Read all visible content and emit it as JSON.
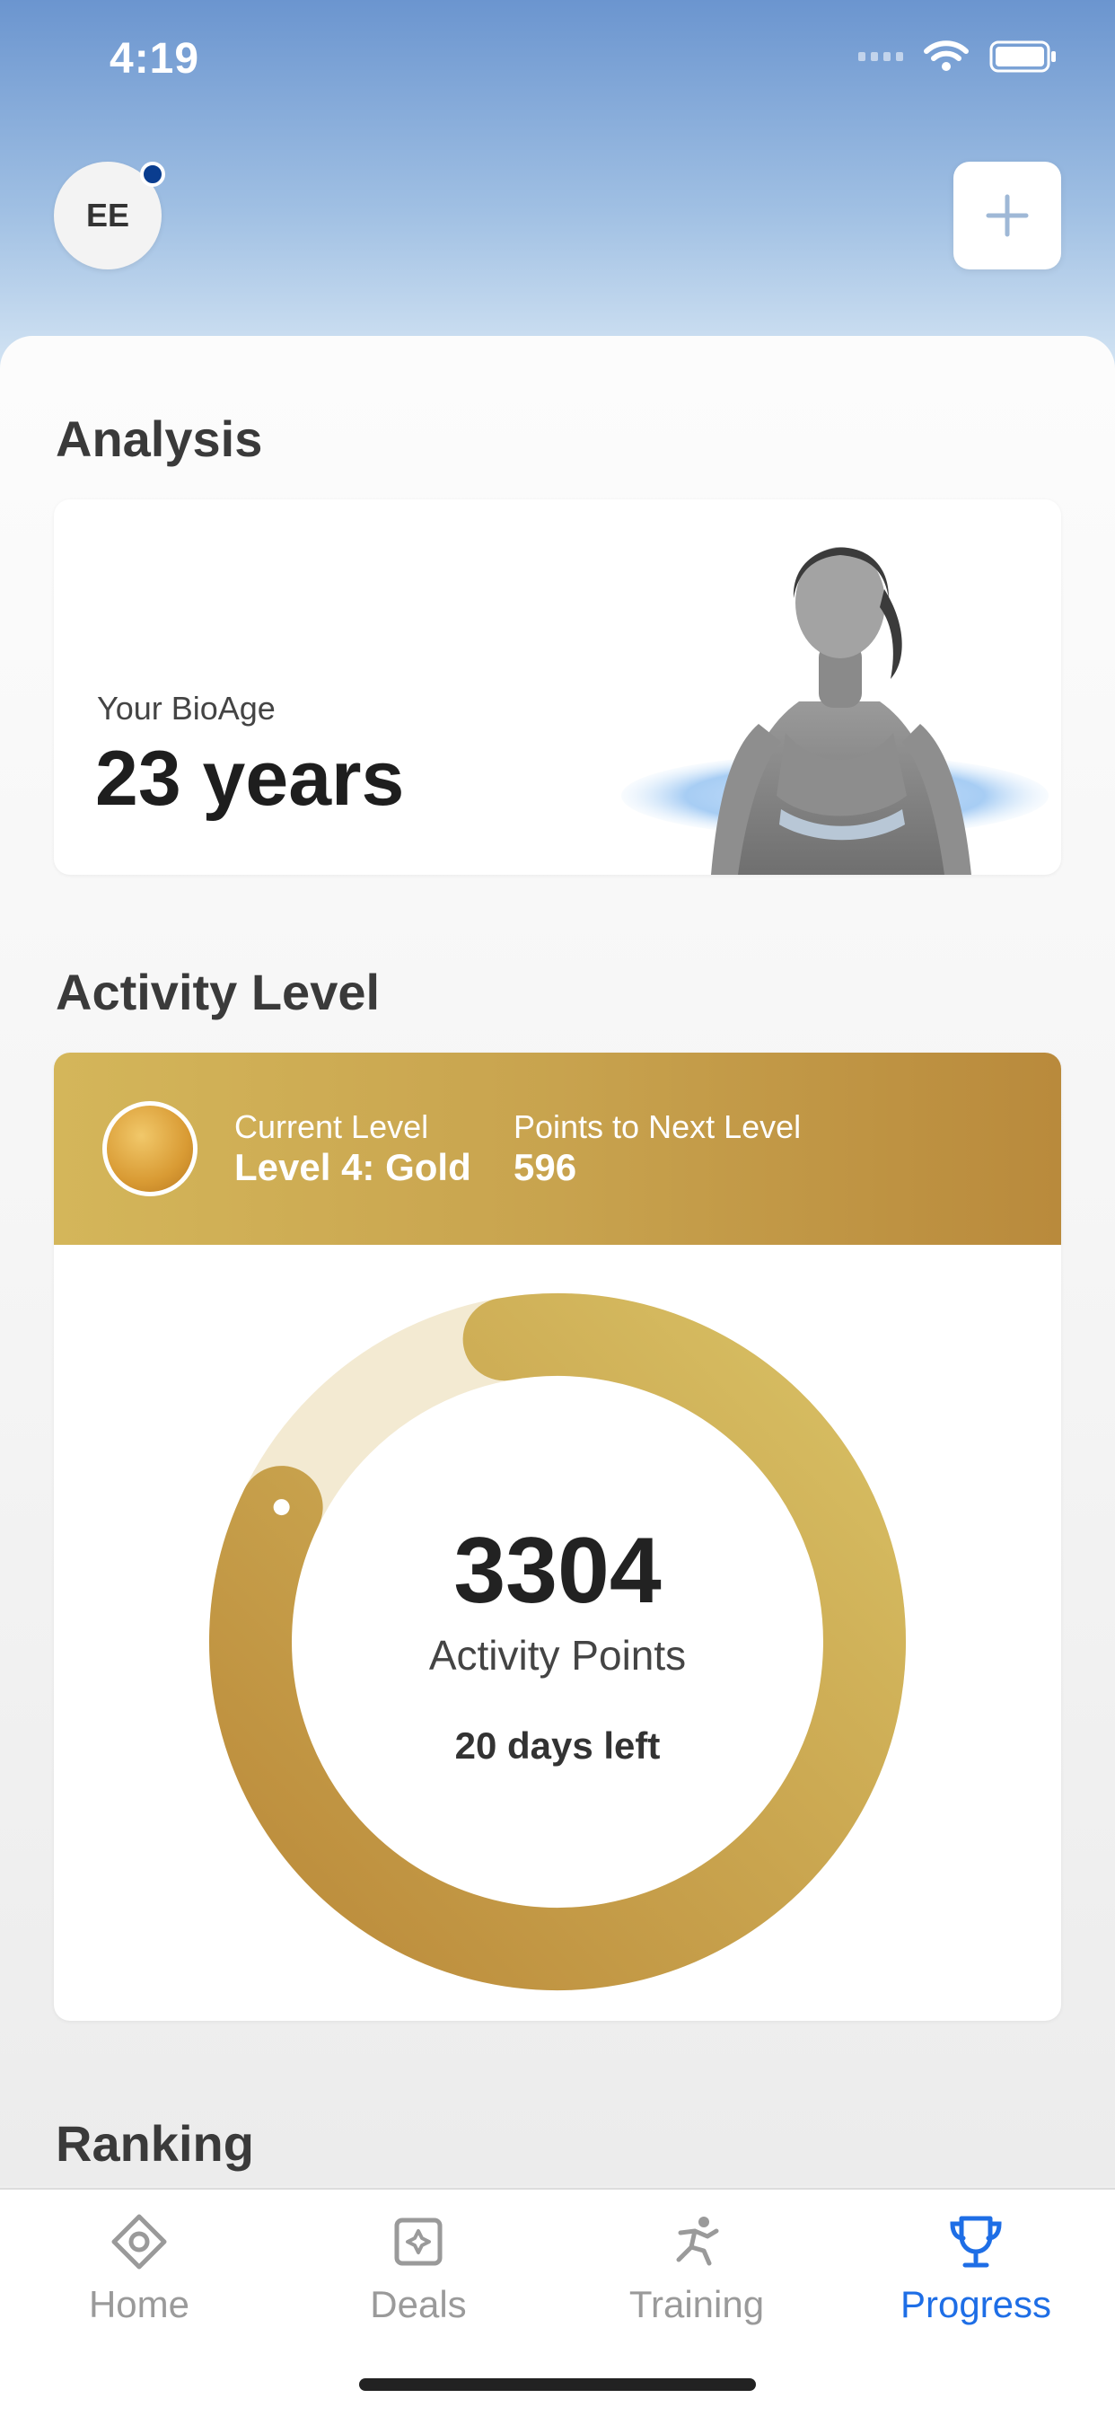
{
  "status_bar": {
    "time": "4:19"
  },
  "header": {
    "avatar_initials": "EE"
  },
  "analysis": {
    "title": "Analysis",
    "bio_label": "Your BioAge",
    "bio_value": "23 years"
  },
  "activity": {
    "title": "Activity Level",
    "current_level_label": "Current Level",
    "current_level_value": "Level 4: Gold",
    "next_level_label": "Points to Next Level",
    "next_level_value": "596",
    "points": "3304",
    "points_label": "Activity Points",
    "days_left": "20 days left",
    "progress_fraction": 0.85
  },
  "ranking": {
    "title": "Ranking"
  },
  "tabs": [
    {
      "label": "Home",
      "icon": "home-diamond-icon"
    },
    {
      "label": "Deals",
      "icon": "deals-icon"
    },
    {
      "label": "Training",
      "icon": "runner-icon"
    },
    {
      "label": "Progress",
      "icon": "trophy-icon"
    }
  ],
  "colors": {
    "accent": "#1e6ee6",
    "gold_light": "#d8c064",
    "gold_dark": "#bb8a3a",
    "ring_track": "#f3ead2"
  }
}
